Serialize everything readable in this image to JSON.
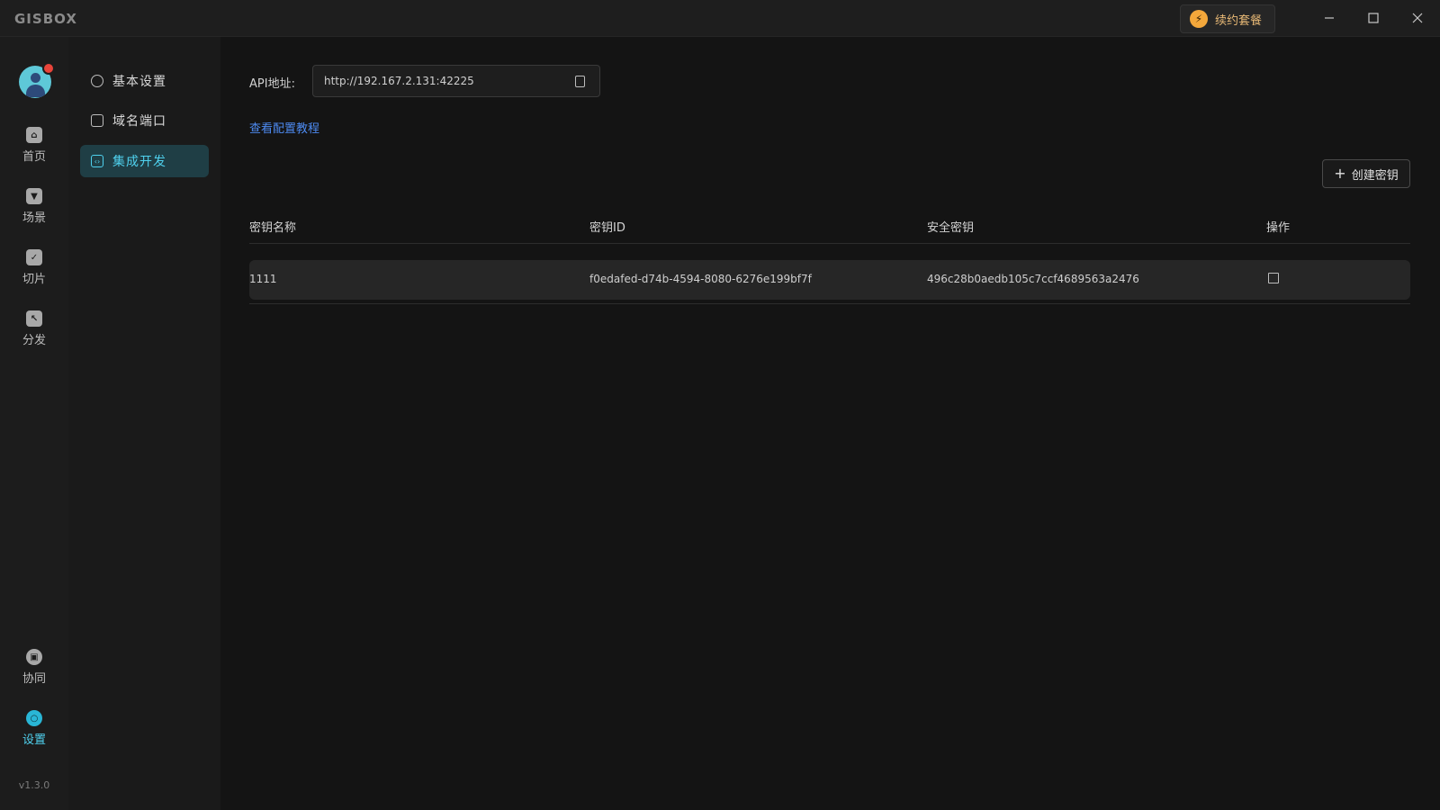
{
  "app": {
    "logo": "GISBOX",
    "renew_label": "续约套餐",
    "version": "v1.3.0"
  },
  "nav": {
    "items": [
      {
        "label": "首页",
        "icon": "home-icon"
      },
      {
        "label": "场景",
        "icon": "scene-cube-icon"
      },
      {
        "label": "切片",
        "icon": "tile-check-icon"
      },
      {
        "label": "分发",
        "icon": "distribute-icon"
      },
      {
        "label": "协同",
        "icon": "lock-icon"
      },
      {
        "label": "设置",
        "icon": "settings-icon"
      }
    ]
  },
  "submenu": {
    "items": [
      {
        "label": "基本设置",
        "icon": "gear-icon"
      },
      {
        "label": "域名端口",
        "icon": "document-icon"
      },
      {
        "label": "集成开发",
        "icon": "code-folder-icon"
      }
    ]
  },
  "api": {
    "label": "API地址:",
    "value": "http://192.167.2.131:42225"
  },
  "tutorial_link": "查看配置教程",
  "create_button": "创建密钥",
  "table": {
    "headers": [
      "密钥名称",
      "密钥ID",
      "安全密钥",
      "操作"
    ],
    "rows": [
      {
        "name": "1111",
        "id": "f0edafed-d74b-4594-8080-6276e199bf7f",
        "secret": "496c28b0aedb105c7ccf4689563a2476"
      }
    ]
  },
  "colors": {
    "accent": "#4fd1ee",
    "link": "#4d8af0",
    "renew": "#f3a73b"
  }
}
